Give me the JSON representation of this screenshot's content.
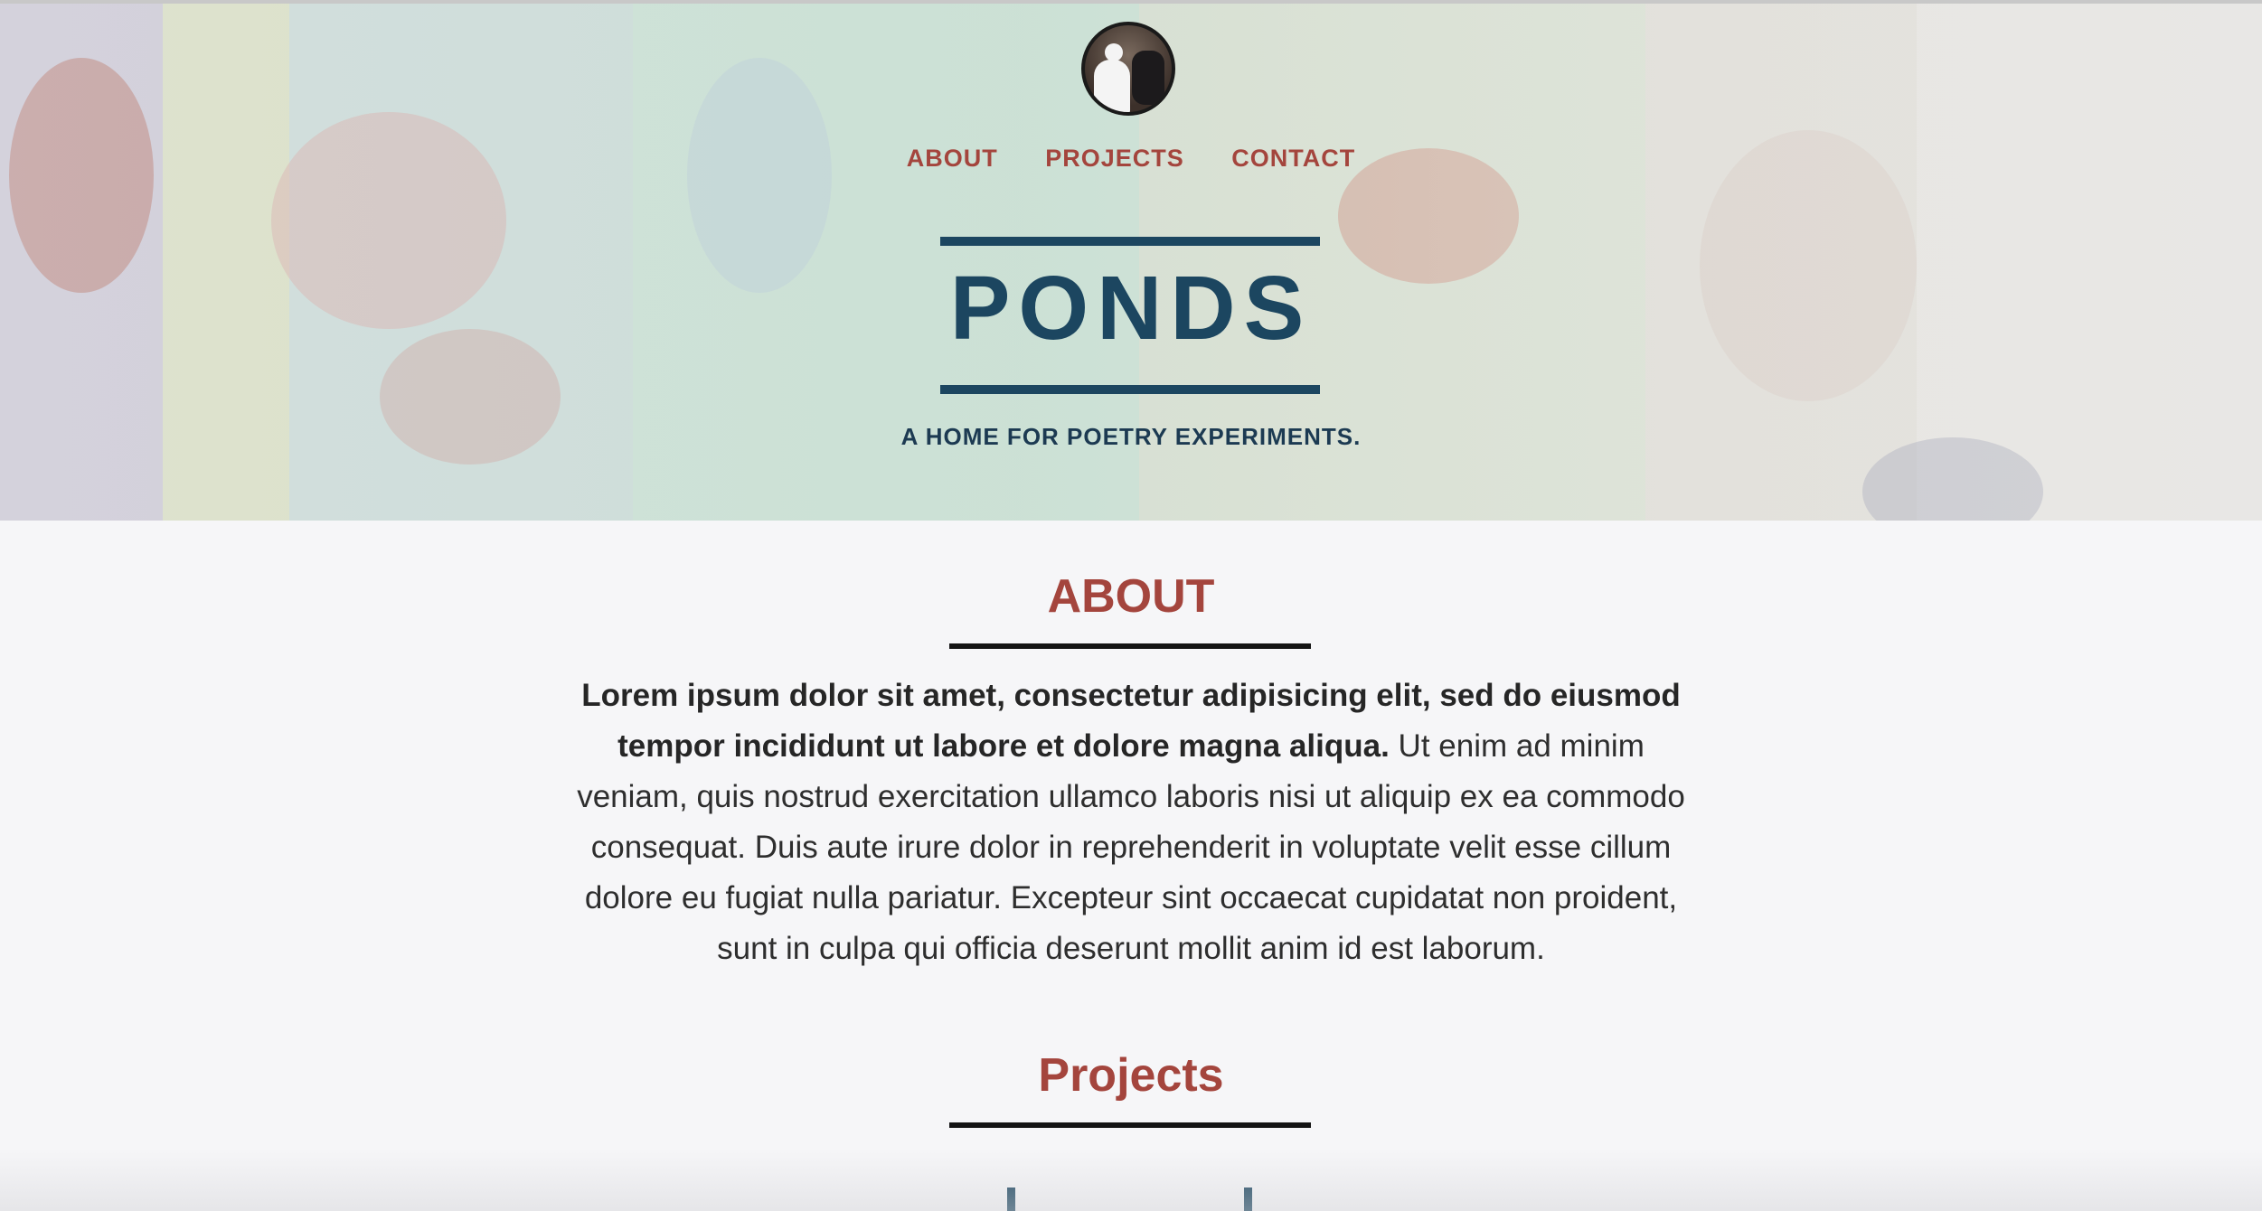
{
  "colors": {
    "accent": "#a4453d",
    "brand_blue": "#1c4660",
    "background": "#f6f6f8",
    "text": "#2e2e2e"
  },
  "header": {
    "avatar_icon": "profile-photo",
    "nav": [
      {
        "label": "ABOUT"
      },
      {
        "label": "PROJECTS"
      },
      {
        "label": "CONTACT"
      }
    ],
    "title": "PONDS",
    "tagline": "A HOME FOR POETRY EXPERIMENTS."
  },
  "about": {
    "heading": "ABOUT",
    "lead": "Lorem ipsum dolor sit amet, consectetur adipisicing elit, sed do eiusmod tempor incididunt ut labore et dolore magna aliqua.",
    "body": " Ut enim ad minim veniam, quis nostrud exercitation ullamco laboris nisi ut aliquip ex ea commodo consequat. Duis aute irure dolor in reprehenderit in voluptate velit esse cillum dolore eu fugiat nulla pariatur. Excepteur sint occaecat cupidatat non proident, sunt in culpa qui officia deserunt mollit anim id est laborum."
  },
  "projects": {
    "heading": "Projects"
  }
}
